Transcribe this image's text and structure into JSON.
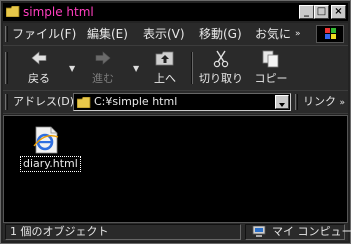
{
  "window": {
    "title": "simple html",
    "buttons": {
      "minimize": "_",
      "maximize": "□",
      "close": "×"
    }
  },
  "menu": {
    "items": [
      "ファイル(F)",
      "編集(E)",
      "表示(V)",
      "移動(G)",
      "お気に"
    ]
  },
  "toolbar": {
    "back": "戻る",
    "forward": "進む",
    "up": "上へ",
    "cut": "切り取り",
    "copy": "コピー"
  },
  "address": {
    "label": "アドレス(D)",
    "value": "C:¥simple html",
    "links_label": "リンク"
  },
  "files": [
    {
      "name": "diary.html",
      "icon": "ie-html-file-icon"
    }
  ],
  "status": {
    "left": "1 個のオブジェクト",
    "right": "マイ コンピュータ"
  },
  "colors": {
    "title_text": "#ff3fbf",
    "window_bg": "#232323",
    "content_bg": "#000000"
  }
}
